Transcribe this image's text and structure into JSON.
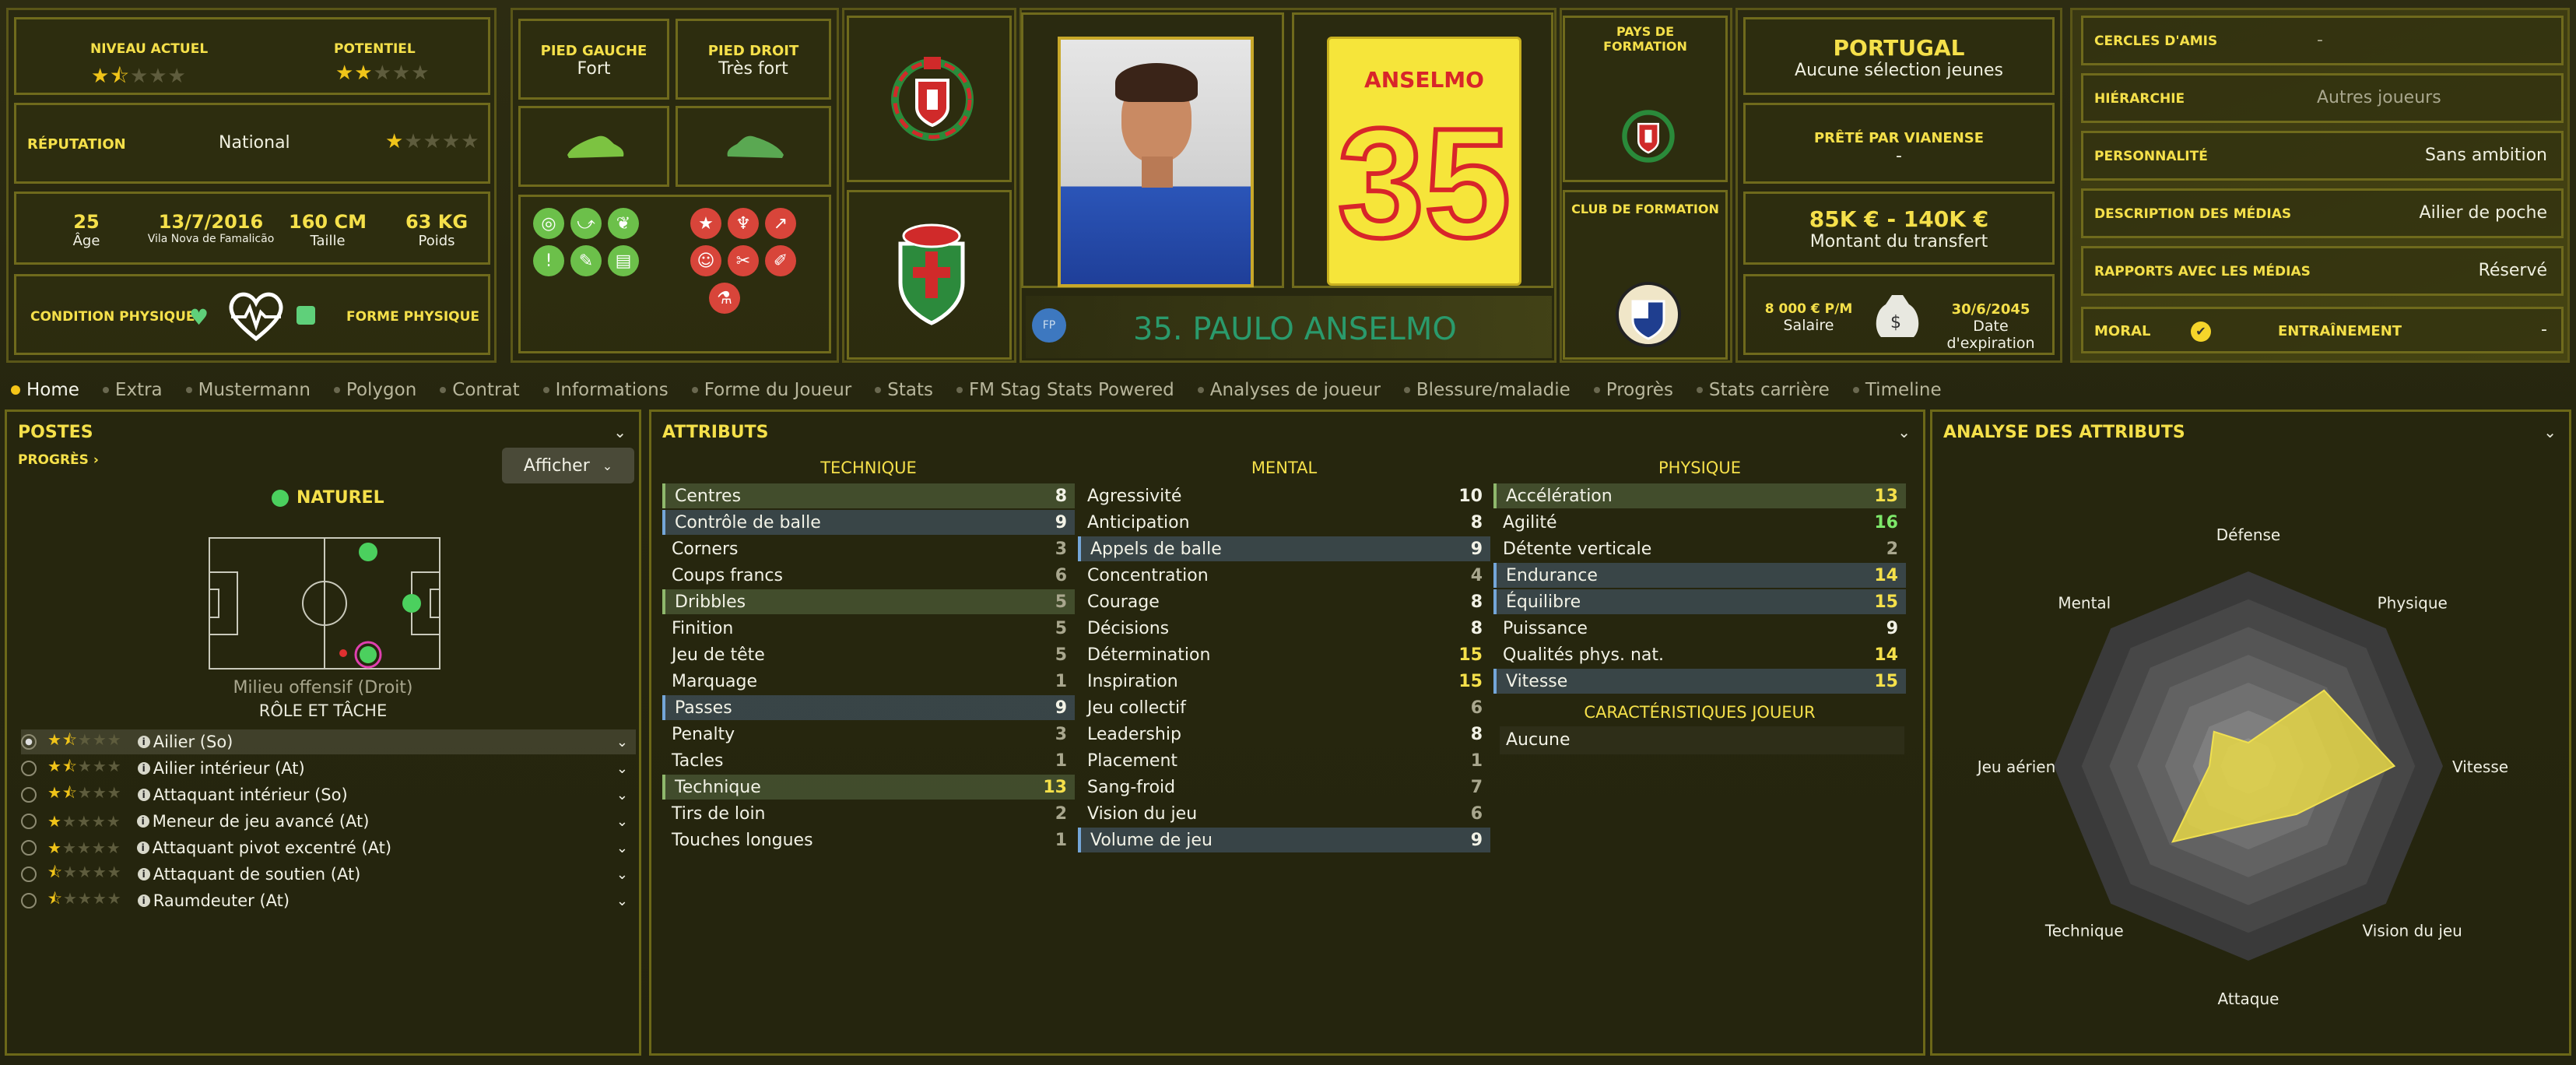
{
  "header": {
    "niveau_label": "NIVEAU ACTUEL",
    "potentiel_label": "POTENTIEL",
    "niveau_stars": 1.5,
    "potentiel_stars": 2,
    "reputation_label": "RÉPUTATION",
    "reputation_value": "National",
    "reputation_stars": 1,
    "age_value": "25",
    "age_label": "Âge",
    "birth_value": "13/7/2016",
    "birth_place": "Vila Nova de Famalicão",
    "height_value": "160 CM",
    "height_label": "Taille",
    "weight_value": "63 KG",
    "weight_label": "Poids",
    "condition_label": "CONDITION PHYSIQUE",
    "forme_label": "FORME PHYSIQUE",
    "pied_gauche_label": "PIED GAUCHE",
    "pied_gauche_value": "Fort",
    "pied_droit_label": "PIED DROIT",
    "pied_droit_value": "Très fort",
    "shirt_name": "ANSELMO",
    "shirt_number": "35",
    "player_name": "35. PAULO ANSELMO",
    "badge": "FP",
    "pays_formation_label": "PAYS DE FORMATION",
    "club_formation_label": "CLUB DE FORMATION",
    "nation": "PORTUGAL",
    "nation_sub": "Aucune sélection jeunes",
    "loan_label": "PRÊTÉ PAR VIANENSE",
    "loan_value": "-",
    "transfer_value": "85K € - 140K €",
    "transfer_label": "Montant du transfert",
    "salary_value": "8 000 € P/M",
    "salary_label": "Salaire",
    "expiry_value": "30/6/2045",
    "expiry_label": "Date d'expiration"
  },
  "right_info": [
    {
      "label": "CERCLES D'AMIS",
      "value": "-"
    },
    {
      "label": "HIÉRARCHIE",
      "value": "Autres joueurs"
    },
    {
      "label": "PERSONNALITÉ",
      "value": "Sans ambition"
    },
    {
      "label": "DESCRIPTION DES MÉDIAS",
      "value": "Ailier de poche"
    },
    {
      "label": "RAPPORTS AVEC LES MÉDIAS",
      "value": "Réservé"
    }
  ],
  "moral_label": "MORAL",
  "entrainement_label": "ENTRAÎNEMENT",
  "entrainement_value": "-",
  "tabs": [
    "Home",
    "Extra",
    "Mustermann",
    "Polygon",
    "Contrat",
    "Informations",
    "Forme du Joueur",
    "Stats",
    "FM Stag Stats Powered",
    "Analyses de joueur",
    "Blessure/maladie",
    "Progrès",
    "Stats carrière",
    "Timeline"
  ],
  "postes": {
    "title": "POSTES",
    "progres": "PROGRÈS",
    "afficher": "Afficher",
    "naturel": "NATUREL",
    "position": "Milieu offensif (Droit)",
    "role_title": "RÔLE ET TÂCHE",
    "roles": [
      {
        "stars": 1.5,
        "name": "Ailier (So)"
      },
      {
        "stars": 1.5,
        "name": "Ailier intérieur (At)"
      },
      {
        "stars": 1.5,
        "name": "Attaquant intérieur (So)"
      },
      {
        "stars": 1,
        "name": "Meneur de jeu avancé (At)"
      },
      {
        "stars": 1,
        "name": "Attaquant pivot excentré (At)"
      },
      {
        "stars": 0.5,
        "name": "Attaquant de soutien (At)"
      },
      {
        "stars": 0.5,
        "name": "Raumdeuter (At)"
      }
    ]
  },
  "attributs": {
    "title": "ATTRIBUTS",
    "tech_title": "TECHNIQUE",
    "mental_title": "MENTAL",
    "phys_title": "PHYSIQUE",
    "technique": [
      {
        "n": "Centres",
        "v": "8",
        "h": "g"
      },
      {
        "n": "Contrôle de balle",
        "v": "9",
        "h": "b"
      },
      {
        "n": "Corners",
        "v": "3",
        "h": ""
      },
      {
        "n": "Coups francs",
        "v": "6",
        "h": ""
      },
      {
        "n": "Dribbles",
        "v": "5",
        "h": "g"
      },
      {
        "n": "Finition",
        "v": "5",
        "h": ""
      },
      {
        "n": "Jeu de tête",
        "v": "5",
        "h": ""
      },
      {
        "n": "Marquage",
        "v": "1",
        "h": ""
      },
      {
        "n": "Passes",
        "v": "9",
        "h": "b"
      },
      {
        "n": "Penalty",
        "v": "3",
        "h": ""
      },
      {
        "n": "Tacles",
        "v": "1",
        "h": ""
      },
      {
        "n": "Technique",
        "v": "13",
        "h": "g"
      },
      {
        "n": "Tirs de loin",
        "v": "2",
        "h": ""
      },
      {
        "n": "Touches longues",
        "v": "1",
        "h": ""
      }
    ],
    "mental": [
      {
        "n": "Agressivité",
        "v": "10",
        "h": ""
      },
      {
        "n": "Anticipation",
        "v": "8",
        "h": ""
      },
      {
        "n": "Appels de balle",
        "v": "9",
        "h": "b"
      },
      {
        "n": "Concentration",
        "v": "4",
        "h": ""
      },
      {
        "n": "Courage",
        "v": "8",
        "h": ""
      },
      {
        "n": "Décisions",
        "v": "8",
        "h": ""
      },
      {
        "n": "Détermination",
        "v": "15",
        "h": ""
      },
      {
        "n": "Inspiration",
        "v": "15",
        "h": ""
      },
      {
        "n": "Jeu collectif",
        "v": "6",
        "h": ""
      },
      {
        "n": "Leadership",
        "v": "8",
        "h": ""
      },
      {
        "n": "Placement",
        "v": "1",
        "h": ""
      },
      {
        "n": "Sang-froid",
        "v": "7",
        "h": ""
      },
      {
        "n": "Vision du jeu",
        "v": "6",
        "h": ""
      },
      {
        "n": "Volume de jeu",
        "v": "9",
        "h": "b"
      }
    ],
    "physique": [
      {
        "n": "Accélération",
        "v": "13",
        "h": "g"
      },
      {
        "n": "Agilité",
        "v": "16",
        "h": ""
      },
      {
        "n": "Détente verticale",
        "v": "2",
        "h": ""
      },
      {
        "n": "Endurance",
        "v": "14",
        "h": "b"
      },
      {
        "n": "Équilibre",
        "v": "15",
        "h": "b"
      },
      {
        "n": "Puissance",
        "v": "9",
        "h": ""
      },
      {
        "n": "Qualités phys. nat.",
        "v": "14",
        "h": ""
      },
      {
        "n": "Vitesse",
        "v": "15",
        "h": "b"
      }
    ],
    "carac_title": "CARACTÉRISTIQUES JOUEUR",
    "carac_value": "Aucune"
  },
  "analyse": {
    "title": "ANALYSE DES ATTRIBUTS",
    "axes": [
      "Défense",
      "Physique",
      "Vitesse",
      "Vision du jeu",
      "Attaque",
      "Technique",
      "Jeu aérien",
      "Mental"
    ]
  },
  "colors": {
    "accent": "#f5e04a",
    "panel_border": "#6c6818"
  }
}
